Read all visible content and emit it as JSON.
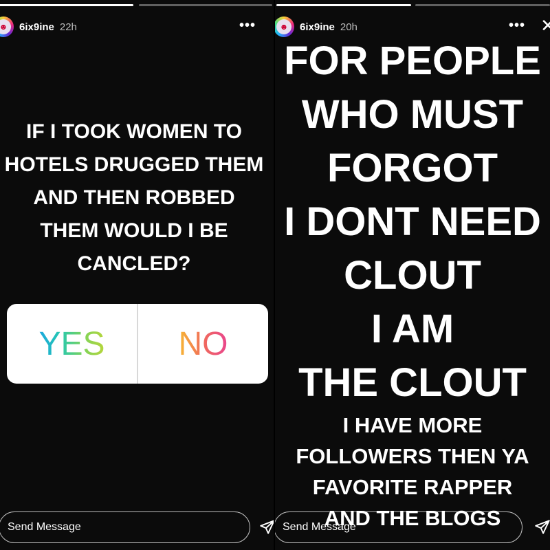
{
  "left_story": {
    "username": "6ix9ine",
    "time": "22h",
    "more": "•••",
    "question_lines": [
      "IF I TOOK WOMEN TO",
      "HOTELS DRUGGED THEM",
      "AND THEN ROBBED",
      "THEM WOULD I BE",
      "CANCLED?"
    ],
    "poll": {
      "yes_label": "YES",
      "no_label": "NO"
    },
    "message_placeholder": "Send Message"
  },
  "right_story": {
    "username": "6ix9ine",
    "time": "20h",
    "more": "•••",
    "close": "✕",
    "big_lines": [
      "FOR PEOPLE",
      "WHO MUST",
      "FORGOT",
      "I DONT NEED",
      "CLOUT",
      "I AM",
      "THE CLOUT"
    ],
    "small_lines": [
      "I HAVE MORE",
      "FOLLOWERS THEN YA",
      "FAVORITE RAPPER",
      "AND THE BLOGS"
    ],
    "message_placeholder": "Send Message"
  },
  "icons": {
    "avatar": "avatar-icon",
    "more": "more-options-icon",
    "send": "send-icon",
    "close": "close-icon"
  }
}
